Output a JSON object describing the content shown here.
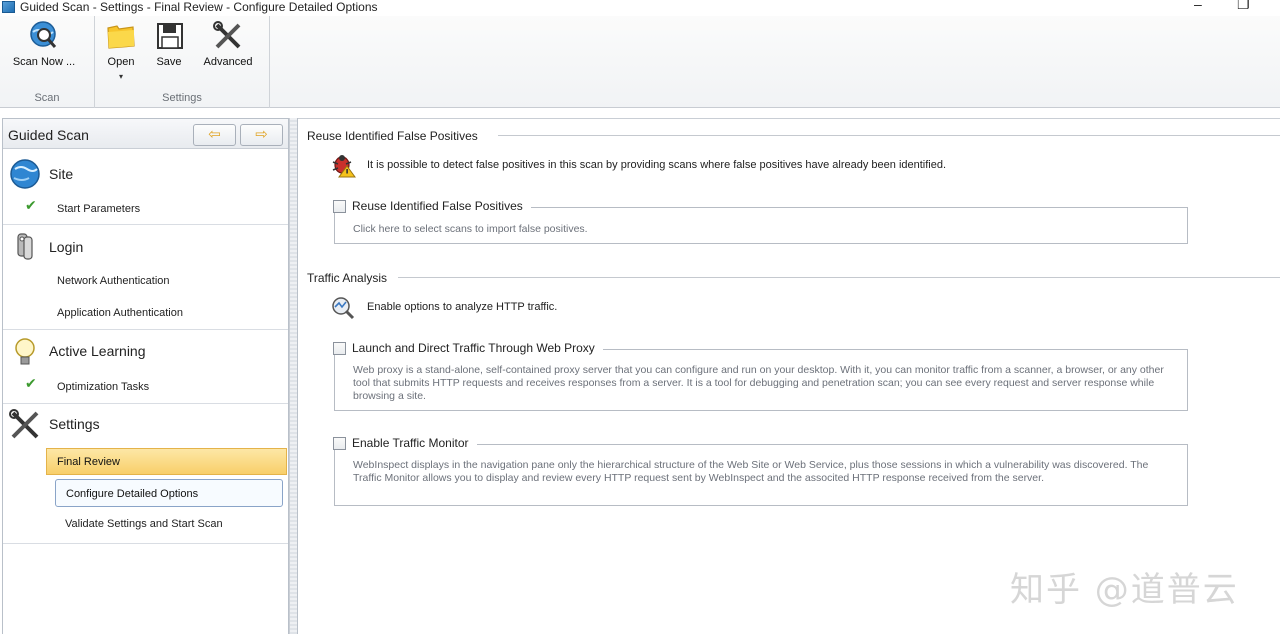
{
  "window": {
    "title": "Guided Scan - Settings - Final Review - Configure Detailed Options",
    "minimize_glyph": "–",
    "restore_glyph": "❐"
  },
  "ribbon": {
    "groups": {
      "scan_label": "Scan",
      "settings_label": "Settings"
    },
    "buttons": {
      "scan_now": "Scan Now ...",
      "open": "Open",
      "open_dropdown": "▾",
      "save": "Save",
      "advanced": "Advanced"
    }
  },
  "nav": {
    "header": "Guided Scan",
    "back_arrow": "⇦",
    "forward_arrow": "⇨",
    "sections": {
      "site": {
        "title": "Site",
        "items": [
          "Start Parameters"
        ]
      },
      "login": {
        "title": "Login",
        "items": [
          "Network Authentication",
          "Application Authentication"
        ]
      },
      "active_learning": {
        "title": "Active Learning",
        "items": [
          "Optimization Tasks"
        ]
      },
      "settings": {
        "title": "Settings",
        "items": [
          "Final Review",
          "Configure Detailed Options",
          "Validate Settings and Start Scan"
        ]
      }
    },
    "check_glyph": "✔"
  },
  "main": {
    "reuse_group": {
      "title": "Reuse Identified False Positives",
      "info": "It is possible to detect false positives in this scan by providing scans where false positives have already been identified.",
      "option": {
        "label": "Reuse Identified False Positives",
        "description": "Click here to select scans to import false positives."
      }
    },
    "traffic_group": {
      "title": "Traffic Analysis",
      "info": "Enable options to analyze HTTP traffic.",
      "proxy_option": {
        "label": "Launch and Direct Traffic Through Web Proxy",
        "description": "Web proxy is a stand-alone, self-contained proxy server that you can configure and run on your desktop.  With it, you can monitor traffic from a scanner, a browser, or any other tool that submits HTTP requests and receives responses from a server.  It is a tool for debugging and penetration scan; you can see every request and server response while browsing a site."
      },
      "monitor_option": {
        "label": "Enable Traffic Monitor",
        "description": "WebInspect displays in the navigation pane only the hierarchical structure of the Web Site or Web Service, plus those sessions in which a vulnerability was discovered.  The Traffic Monitor allows you to display and review every HTTP request sent by WebInspect and the associted HTTP response received from the server."
      }
    }
  },
  "watermark": "知乎 @道普云"
}
